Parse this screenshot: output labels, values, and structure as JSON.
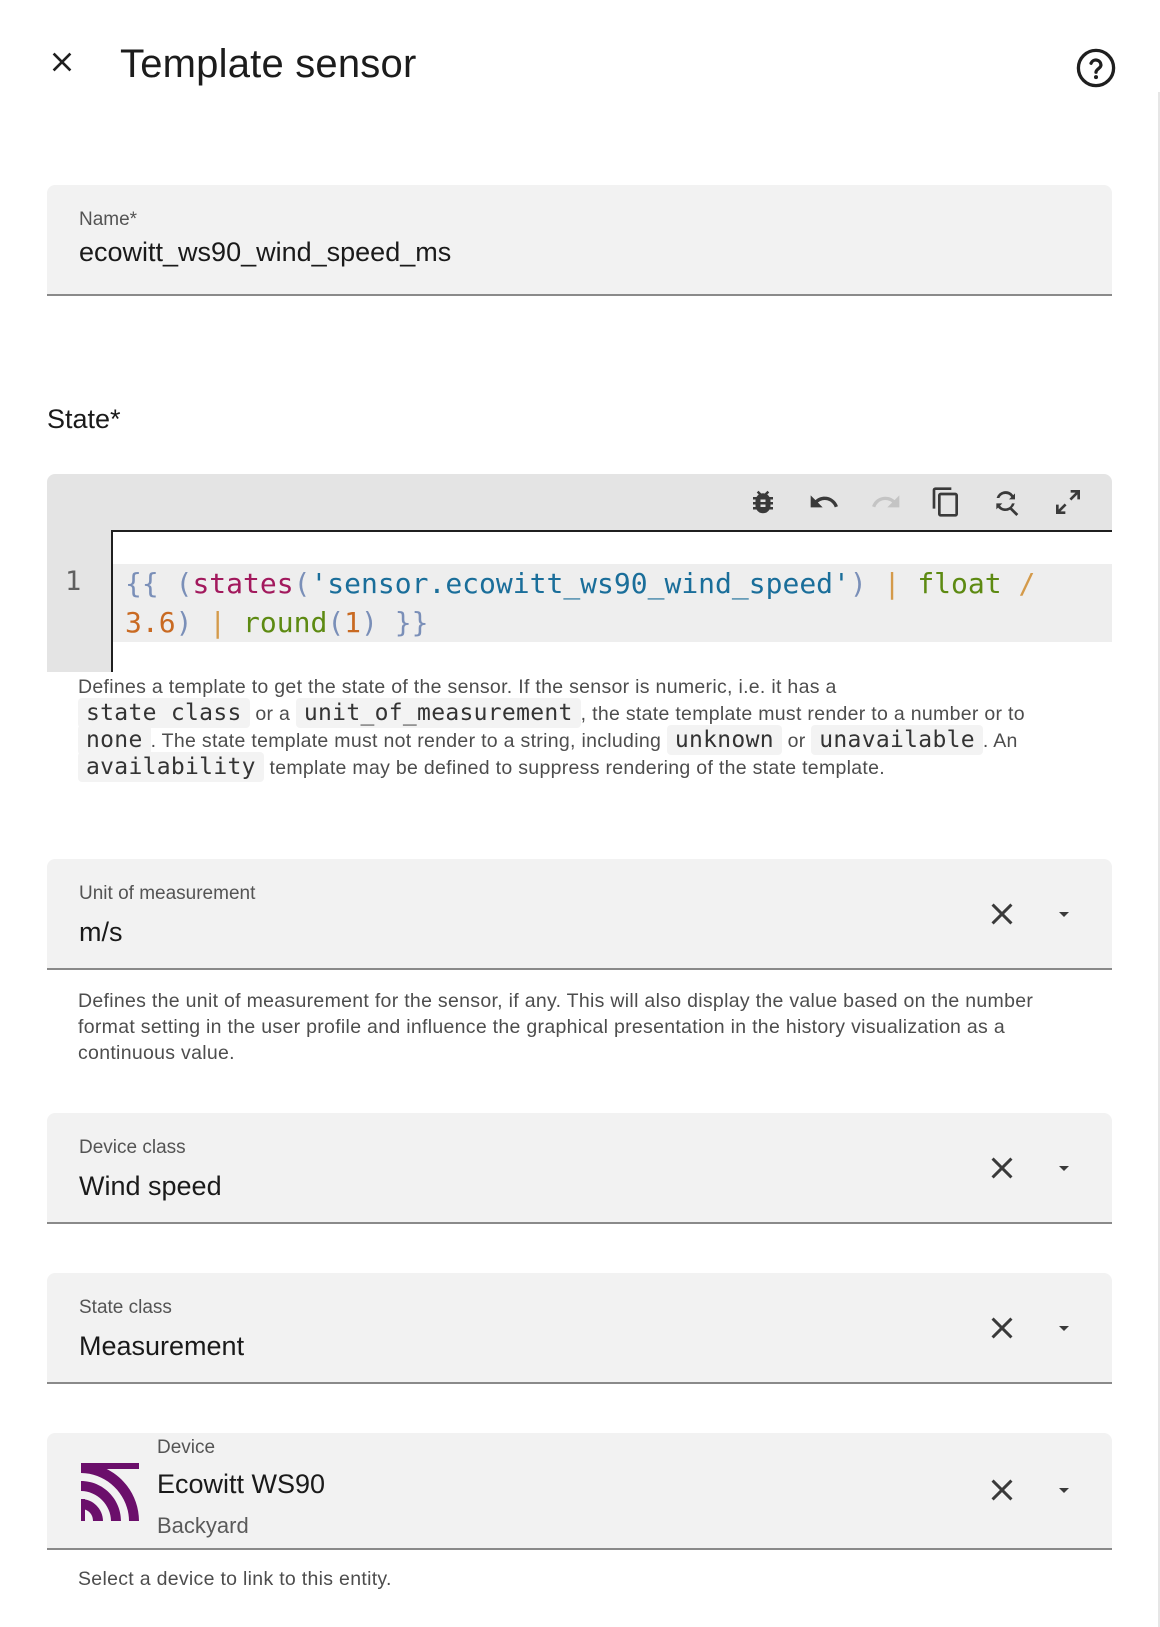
{
  "header": {
    "title": "Template sensor",
    "close_icon": "close-icon",
    "help_icon": "help-circle-icon"
  },
  "name_field": {
    "label": "Name*",
    "value": "ecowitt_ws90_wind_speed_ms"
  },
  "state": {
    "label": "State*",
    "toolbar": [
      "bug-icon",
      "undo-icon",
      "redo-icon",
      "copy-icon",
      "search-replace-icon",
      "fullscreen-icon"
    ],
    "line_number": "1",
    "code_tokens": [
      {
        "t": "{{",
        "c": "brace"
      },
      {
        "t": " (",
        "c": "brace"
      },
      {
        "t": "states",
        "c": "fn"
      },
      {
        "t": "(",
        "c": "brace"
      },
      {
        "t": "'sensor.ecowitt_ws90_wind_speed'",
        "c": "str"
      },
      {
        "t": ")",
        "c": "brace"
      },
      {
        "t": " | ",
        "c": "pipe"
      },
      {
        "t": "float",
        "c": "filter"
      },
      {
        "t": " /",
        "c": "pipe"
      },
      {
        "t": " 3.6",
        "c": "num"
      },
      {
        "t": ")",
        "c": "brace"
      },
      {
        "t": " | ",
        "c": "pipe"
      },
      {
        "t": "round",
        "c": "filter"
      },
      {
        "t": "(",
        "c": "brace"
      },
      {
        "t": "1",
        "c": "num"
      },
      {
        "t": ")",
        "c": "brace"
      },
      {
        "t": " }}",
        "c": "brace"
      }
    ],
    "helper": {
      "p1": "Defines a template to get the state of the sensor. If the sensor is numeric, i.e. it has a",
      "c1": "state class",
      "p2": "or a",
      "c2": "unit_of_measurement",
      "p3": ", the state template must render to a number or to",
      "c3": "none",
      "p4": ". The state template must not render to a string, including",
      "c4": "unknown",
      "p5": "or",
      "c5": "unavailable",
      "p6": ". An",
      "c6": "availability",
      "p7": "template may be defined to suppress rendering of the state template."
    }
  },
  "unit_field": {
    "label": "Unit of measurement",
    "value": "m/s",
    "helper": "Defines the unit of measurement for the sensor, if any. This will also display the value based on the number format setting in the user profile and influence the graphical presentation in the history visualization as a continuous value."
  },
  "device_class_field": {
    "label": "Device class",
    "value": "Wind speed"
  },
  "state_class_field": {
    "label": "State class",
    "value": "Measurement"
  },
  "device_field": {
    "label": "Device",
    "value": "Ecowitt WS90",
    "subtitle": "Backyard",
    "icon": "ecowitt-logo-icon",
    "helper": "Select a device to link to this entity."
  },
  "colors": {
    "field_bg": "#f2f2f2",
    "toolbar_bg": "#e4e4e4",
    "logo": "#6b0f6b"
  }
}
